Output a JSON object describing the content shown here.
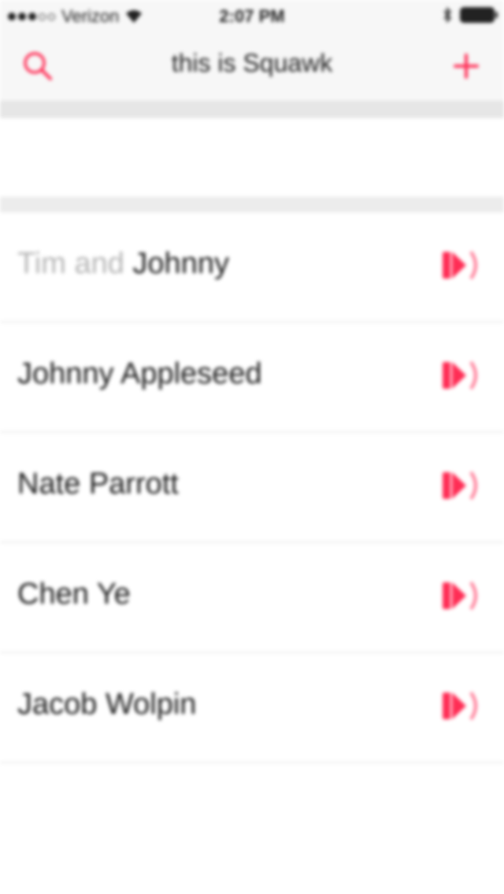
{
  "status_bar": {
    "carrier": "Verizon",
    "time": "2:07 PM"
  },
  "nav": {
    "title": "this is Squawk"
  },
  "conversations": [
    {
      "prefix": "Tim and",
      "name": "Johnny"
    },
    {
      "prefix": "",
      "name": "Johnny Appleseed"
    },
    {
      "prefix": "",
      "name": "Nate Parrott"
    },
    {
      "prefix": "",
      "name": "Chen Ye"
    },
    {
      "prefix": "",
      "name": "Jacob Wolpin"
    }
  ],
  "colors": {
    "accent": "#ff2d55",
    "accent_light": "#ffb3c4",
    "text": "#1c1c1c",
    "muted_text": "#b5b5b5",
    "bar_bg": "#f7f7f7",
    "separator": "#ececec"
  },
  "icons": {
    "search": "search-icon",
    "add": "plus-icon",
    "play": "play-squawk-icon"
  }
}
